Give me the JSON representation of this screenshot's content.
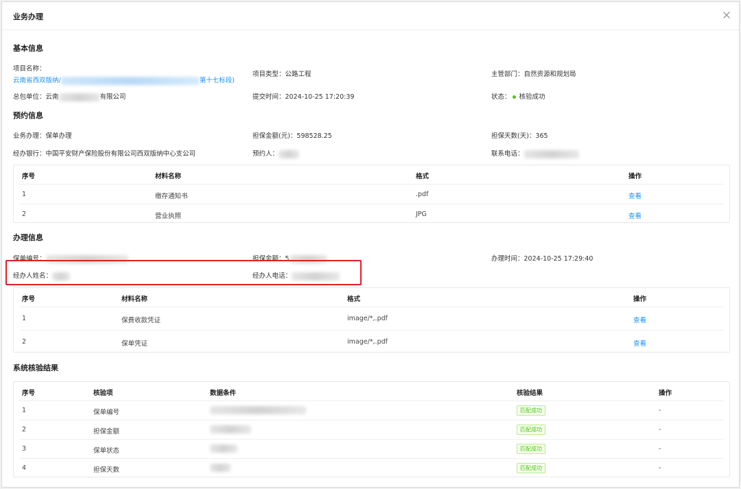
{
  "modal": {
    "title": "业务办理",
    "close_icon": "close-icon"
  },
  "basic": {
    "title": "基本信息",
    "project_name_label": "项目名称：",
    "project_name_prefix": "云南省西双版纳/",
    "project_name_suffix": "第十七标段)",
    "project_type_label": "项目类型：",
    "project_type": "公路工程",
    "dept_label": "主管部门：",
    "dept": "自然资源和规划局",
    "contractor_label": "总包单位：",
    "contractor_prefix": "云南",
    "contractor_suffix": "有限公司",
    "submit_time_label": "提交时间：",
    "submit_time": "2024-10-25 17:20:39",
    "status_label": "状态：",
    "status": "核验成功"
  },
  "booking": {
    "title": "预约信息",
    "business_label": "业务办理：",
    "business": "保单办理",
    "amount_label": "担保金额(元)：",
    "amount": "598528.25",
    "days_label": "担保天数(天)：",
    "days": "365",
    "bank_label": "经办银行：",
    "bank": "中国平安财产保险股份有限公司西双版纳中心支公司",
    "booker_label": "预约人：",
    "phone_label": "联系电话：",
    "table": {
      "headers": [
        "序号",
        "材料名称",
        "格式",
        "操作"
      ],
      "rows": [
        {
          "no": "1",
          "name": "缴存通知书",
          "format": ".pdf",
          "action": "查看"
        },
        {
          "no": "2",
          "name": "营业执照",
          "format": "JPG",
          "action": "查看"
        }
      ]
    }
  },
  "handling": {
    "title": "办理信息",
    "policy_no_label": "保单编号：",
    "amount_label": "担保金额：",
    "amount_prefix": "5",
    "time_label": "办理时间：",
    "time": "2024-10-25 17:29:40",
    "handler_name_label": "经办人姓名：",
    "handler_phone_label": "经办人电话：",
    "table": {
      "headers": [
        "序号",
        "材料名称",
        "格式",
        "操作"
      ],
      "rows": [
        {
          "no": "1",
          "name": "保费收款凭证",
          "format": "image/*,.pdf",
          "action": "查看"
        },
        {
          "no": "2",
          "name": "保单凭证",
          "format": "image/*,.pdf",
          "action": "查看"
        }
      ]
    }
  },
  "verify": {
    "title": "系统核验结果",
    "table": {
      "headers": [
        "序号",
        "核验项",
        "数据条件",
        "核验结果",
        "操作"
      ],
      "rows": [
        {
          "no": "1",
          "item": "保单编号",
          "result": "匹配成功",
          "action": "-"
        },
        {
          "no": "2",
          "item": "担保金额",
          "result": "匹配成功",
          "action": "-"
        },
        {
          "no": "3",
          "item": "保单状态",
          "result": "匹配成功",
          "action": "-"
        },
        {
          "no": "4",
          "item": "担保天数",
          "result": "匹配成功",
          "action": "-"
        }
      ]
    }
  },
  "colors": {
    "link": "#1890ff",
    "success": "#52c41a",
    "highlight": "#e01e25"
  }
}
